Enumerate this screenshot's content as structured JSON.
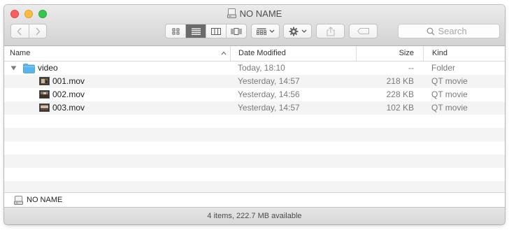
{
  "window": {
    "title": "NO NAME"
  },
  "toolbar": {
    "search_placeholder": "Search",
    "view_modes": [
      "icon",
      "list",
      "column",
      "cover-flow"
    ],
    "active_view": "list"
  },
  "columns": {
    "name": "Name",
    "date": "Date Modified",
    "size": "Size",
    "kind": "Kind"
  },
  "files": [
    {
      "name": "video",
      "date": "Today, 18:10",
      "size": "--",
      "kind": "Folder",
      "icon": "folder-icon"
    },
    {
      "name": "001.mov",
      "date": "Yesterday, 14:57",
      "size": "218 KB",
      "kind": "QT movie",
      "icon": "movie-thumbnail-icon"
    },
    {
      "name": "002.mov",
      "date": "Yesterday, 14:56",
      "size": "228 KB",
      "kind": "QT movie",
      "icon": "movie-thumbnail-icon"
    },
    {
      "name": "003.mov",
      "date": "Yesterday, 14:57",
      "size": "102 KB",
      "kind": "QT movie",
      "icon": "movie-thumbnail-icon"
    }
  ],
  "pathbar": {
    "label": "NO NAME"
  },
  "status": {
    "text": "4 items, 222.7 MB available"
  },
  "colors": {
    "close": "#fc605c",
    "minimize": "#fdbc40",
    "maximize": "#34c84a",
    "folder": "#5ab4ee",
    "stripe": "#f4f4f4"
  }
}
